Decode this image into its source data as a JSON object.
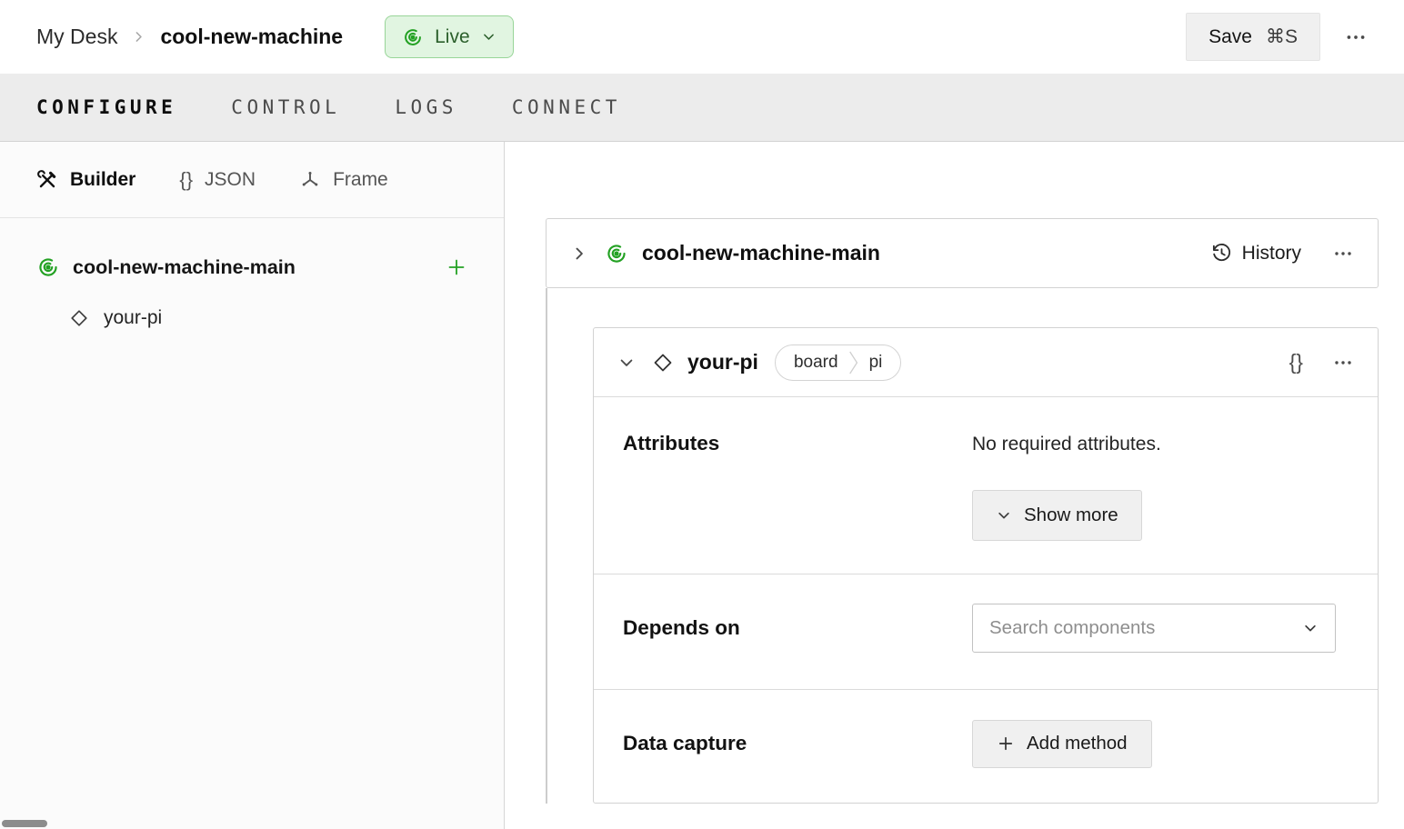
{
  "header": {
    "breadcrumb": {
      "root": "My Desk",
      "current": "cool-new-machine"
    },
    "live": {
      "label": "Live"
    },
    "save": {
      "label": "Save",
      "shortcut": "⌘S"
    }
  },
  "tabs": [
    {
      "label": "CONFIGURE",
      "active": true
    },
    {
      "label": "CONTROL",
      "active": false
    },
    {
      "label": "LOGS",
      "active": false
    },
    {
      "label": "CONNECT",
      "active": false
    }
  ],
  "sidebar": {
    "views": [
      {
        "label": "Builder",
        "icon": "tools-icon",
        "active": true
      },
      {
        "label": "JSON",
        "icon": "curly-braces-icon",
        "active": false
      },
      {
        "label": "Frame",
        "icon": "frame-axes-icon",
        "active": false
      }
    ],
    "tree": {
      "root": {
        "label": "cool-new-machine-main",
        "icon": "machine-part-icon"
      },
      "children": [
        {
          "label": "your-pi",
          "icon": "component-diamond-icon"
        }
      ]
    }
  },
  "main": {
    "machine_card": {
      "title": "cool-new-machine-main",
      "history_label": "History"
    },
    "component_card": {
      "title": "your-pi",
      "type_badge": {
        "category": "board",
        "model": "pi"
      },
      "attributes": {
        "label": "Attributes",
        "empty_text": "No required attributes.",
        "show_more_label": "Show more"
      },
      "depends_on": {
        "label": "Depends on",
        "search_placeholder": "Search components"
      },
      "data_capture": {
        "label": "Data capture",
        "add_method_label": "Add method"
      }
    }
  },
  "icons": {
    "curly_braces": "{}"
  },
  "colors": {
    "live-bg": "#e1f5e1",
    "live-border": "#98d598",
    "live-text": "#2b5f2b",
    "accent-green": "#23a123",
    "tabbar-bg": "#ececec",
    "sidebar-bg": "#fbfbfb",
    "border": "#d2d2d2",
    "button-bg": "#f0f0f0",
    "button-border": "#d7d7d7"
  }
}
